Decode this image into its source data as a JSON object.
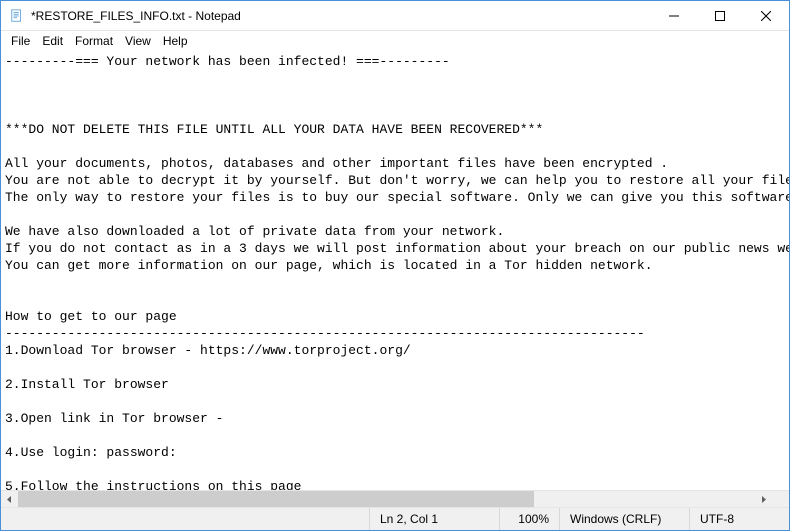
{
  "window": {
    "title": "*RESTORE_FILES_INFO.txt - Notepad"
  },
  "menubar": {
    "file": "File",
    "edit": "Edit",
    "format": "Format",
    "view": "View",
    "help": "Help"
  },
  "content": {
    "text": "---------=== Your network has been infected! ===---------\n\n\n\n***DO NOT DELETE THIS FILE UNTIL ALL YOUR DATA HAVE BEEN RECOVERED***\n\nAll your documents, photos, databases and other important files have been encrypted .\nYou are not able to decrypt it by yourself. But don't worry, we can help you to restore all your files!\nThe only way to restore your files is to buy our special software. Only we can give you this software.\n\nWe have also downloaded a lot of private data from your network.\nIf you do not contact as in a 3 days we will post information about your breach on our public news website.\nYou can get more information on our page, which is located in a Tor hidden network.\n\n\nHow to get to our page\n----------------------------------------------------------------------------------\n1.Download Tor browser - https://www.torproject.org/\n\n2.Install Tor browser\n\n3.Open link in Tor browser - \n\n4.Use login: password: \n\n5.Follow the instructions on this page"
  },
  "statusbar": {
    "position": "Ln 2, Col 1",
    "zoom": "100%",
    "eol": "Windows (CRLF)",
    "encoding": "UTF-8"
  },
  "icons": {
    "app": "notepad-icon",
    "minimize": "minimize-icon",
    "maximize": "maximize-icon",
    "close": "close-icon",
    "scroll_left": "chevron-left-icon",
    "scroll_right": "chevron-right-icon"
  }
}
